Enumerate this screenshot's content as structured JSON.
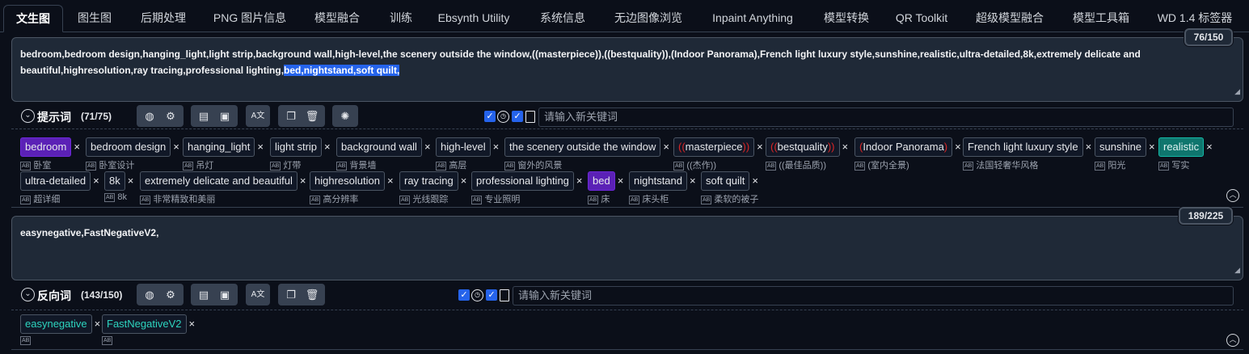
{
  "tabs": [
    {
      "label": "文生图",
      "active": true
    },
    {
      "label": "图生图"
    },
    {
      "label": "后期处理"
    },
    {
      "label": "PNG 图片信息"
    },
    {
      "label": "模型融合"
    },
    {
      "label": "训练"
    },
    {
      "label": "Ebsynth Utility"
    },
    {
      "label": "系统信息"
    },
    {
      "label": "无边图像浏览"
    },
    {
      "label": "Inpaint Anything"
    },
    {
      "label": "模型转换"
    },
    {
      "label": "QR Toolkit"
    },
    {
      "label": "超级模型融合"
    },
    {
      "label": "模型工具箱"
    },
    {
      "label": "WD 1.4 标签器"
    }
  ],
  "positive": {
    "counter": "76/150",
    "text_plain": "bedroom,bedroom design,hanging_light,light strip,background wall,high-level,the scenery outside the window,((masterpiece)),((bestquality)),(Indoor Panorama),French light luxury style,sunshine,realistic,ultra-detailed,8k,extremely delicate and beautiful,highresolution,ray tracing,professional lighting,",
    "text_selected": "bed,nightstand,soft quilt,",
    "label": "提示词",
    "count": "(71/75)",
    "keyword_placeholder": "请输入新关键词",
    "tags": [
      {
        "text": "bedroom",
        "sub": "卧室",
        "style": "purple"
      },
      {
        "text": "bedroom design",
        "sub": "卧室设计"
      },
      {
        "text": "hanging_light",
        "sub": "吊灯"
      },
      {
        "text": "light strip",
        "sub": "灯带"
      },
      {
        "text": "background wall",
        "sub": "背景墙"
      },
      {
        "text": "high-level",
        "sub": "高层"
      },
      {
        "text": "the scenery outside the window",
        "sub": "窗外的风景"
      },
      {
        "pre": "((",
        "text": "masterpiece",
        "post": "))",
        "sub": "((杰作))"
      },
      {
        "pre": "((",
        "text": "bestquality",
        "post": "))",
        "sub": "((最佳品质))"
      },
      {
        "pre": "(",
        "text": "Indoor Panorama",
        "post": ")",
        "sub": "(室内全景)"
      },
      {
        "text": "French light luxury style",
        "sub": "法国轻奢华风格"
      },
      {
        "text": "sunshine",
        "sub": "阳光"
      },
      {
        "text": "realistic",
        "sub": "写实",
        "style": "teal"
      },
      {
        "text": "ultra-detailed",
        "sub": "超详细"
      },
      {
        "text": "8k",
        "sub": "8k"
      },
      {
        "text": "extremely delicate and beautiful",
        "sub": "非常精致和美丽"
      },
      {
        "text": "highresolution",
        "sub": "高分辨率"
      },
      {
        "text": "ray tracing",
        "sub": "光线跟踪"
      },
      {
        "text": "professional lighting",
        "sub": "专业照明"
      },
      {
        "text": "bed",
        "sub": "床",
        "style": "purple"
      },
      {
        "text": "nightstand",
        "sub": "床头柜"
      },
      {
        "text": "soft quilt",
        "sub": "柔软的被子"
      }
    ]
  },
  "negative": {
    "counter": "189/225",
    "text": "easynegative,FastNegativeV2,",
    "label": "反向词",
    "count": "(143/150)",
    "keyword_placeholder": "请输入新关键词",
    "tags": [
      {
        "text": "easynegative",
        "sub": "",
        "style": "neg"
      },
      {
        "text": "FastNegativeV2",
        "sub": "",
        "style": "neg"
      }
    ]
  },
  "colors": {
    "bg": "#0b0f19",
    "accent": "#2563eb",
    "tag_purple": "#5b21b6",
    "tag_teal": "#0f766e"
  },
  "icons": [
    "globe-icon",
    "gear-icon",
    "history-icon",
    "bookmark-icon",
    "translate-icon",
    "copy-icon",
    "trash-icon",
    "openai-icon",
    "checkbox-icon",
    "clock-icon",
    "book-icon",
    "collapse-icon",
    "expand-up-icon",
    "close-icon"
  ]
}
